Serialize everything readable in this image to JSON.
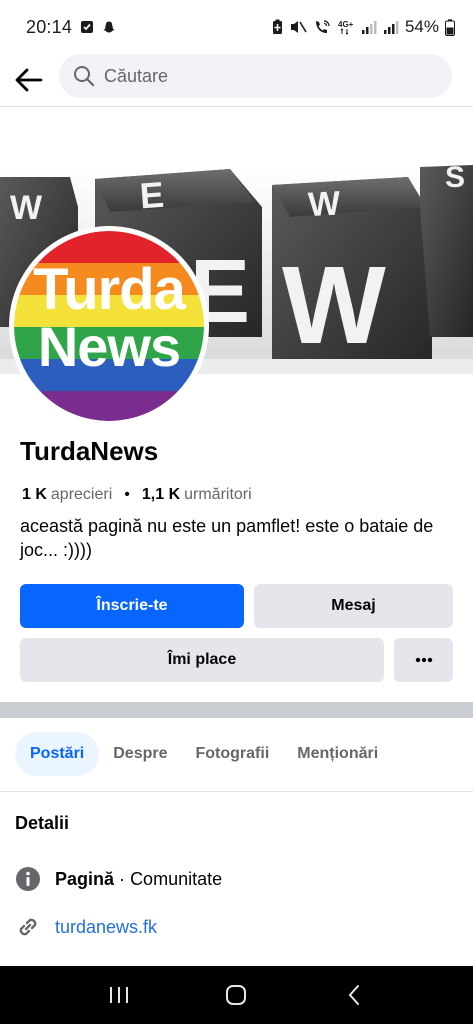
{
  "status_bar": {
    "time": "20:14",
    "network": "4G+",
    "battery": "54%"
  },
  "search": {
    "placeholder": "Căutare"
  },
  "page": {
    "logo_line1": "Turda",
    "logo_line2": "News",
    "cover_letters": [
      "W",
      "E",
      "W",
      "S"
    ],
    "name": "TurdaNews",
    "likes_count": "1 K",
    "likes_label": "aprecieri",
    "separator": "•",
    "followers_count": "1,1 K",
    "followers_label": "urmăritori",
    "bio": "această pagină nu este un pamflet! este o bataie de joc... :))))"
  },
  "actions": {
    "join": "Înscrie-te",
    "message": "Mesaj",
    "like": "Îmi place",
    "more": "•••"
  },
  "tabs": [
    {
      "label": "Postări",
      "active": true
    },
    {
      "label": "Despre",
      "active": false
    },
    {
      "label": "Fotografii",
      "active": false
    },
    {
      "label": "Menționări",
      "active": false
    }
  ],
  "details": {
    "title": "Detalii",
    "type_label": "Pagină",
    "type_separator": "·",
    "type_value": "Comunitate",
    "website": "turdanews.fk"
  },
  "colors": {
    "primary": "#0866ff",
    "button_gray": "#e4e6eb",
    "link": "#216fdb",
    "tab_active_bg": "#ebf5ff"
  }
}
